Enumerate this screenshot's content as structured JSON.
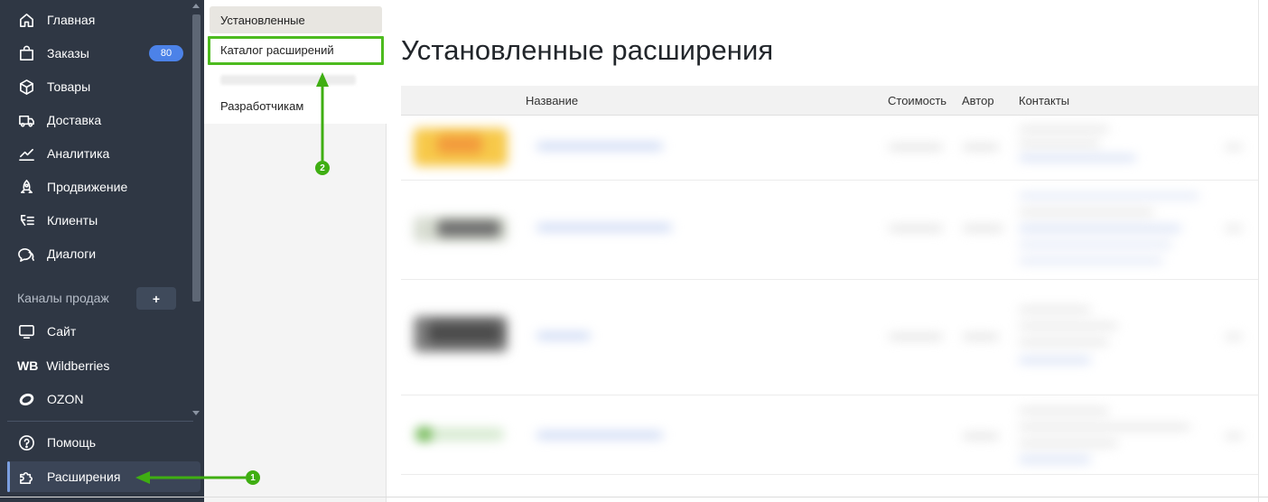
{
  "sidebar": {
    "items": [
      {
        "label": "Главная",
        "icon": "home-icon"
      },
      {
        "label": "Заказы",
        "icon": "shopping-bag-icon",
        "badge": "80"
      },
      {
        "label": "Товары",
        "icon": "box-icon"
      },
      {
        "label": "Доставка",
        "icon": "truck-icon"
      },
      {
        "label": "Аналитика",
        "icon": "chart-line-icon"
      },
      {
        "label": "Продвижение",
        "icon": "rocket-icon"
      },
      {
        "label": "Клиенты",
        "icon": "clients-icon"
      },
      {
        "label": "Диалоги",
        "icon": "chat-icon"
      }
    ],
    "channels_label": "Каналы продаж",
    "add_label": "+",
    "channels": [
      {
        "label": "Сайт",
        "icon": "monitor-icon"
      },
      {
        "label": "Wildberries",
        "icon_text": "WB"
      },
      {
        "label": "OZON",
        "icon": "ozon-icon"
      }
    ],
    "help": {
      "label": "Помощь",
      "icon": "help-circle-icon"
    },
    "extensions": {
      "label": "Расширения",
      "icon": "puzzle-icon"
    }
  },
  "submenu": {
    "items": [
      "Установленные",
      "Каталог расширений",
      "",
      "Разработчикам"
    ]
  },
  "main": {
    "title": "Установленные расширения",
    "columns": [
      "Название",
      "Стоимость",
      "Автор",
      "Контакты"
    ]
  },
  "annotations": {
    "step1": "1",
    "step2": "2",
    "color": "#3fae12"
  },
  "colors": {
    "sidebar_bg": "#2f3744",
    "badge": "#4c82e8",
    "highlight": "#4dbb1f"
  }
}
